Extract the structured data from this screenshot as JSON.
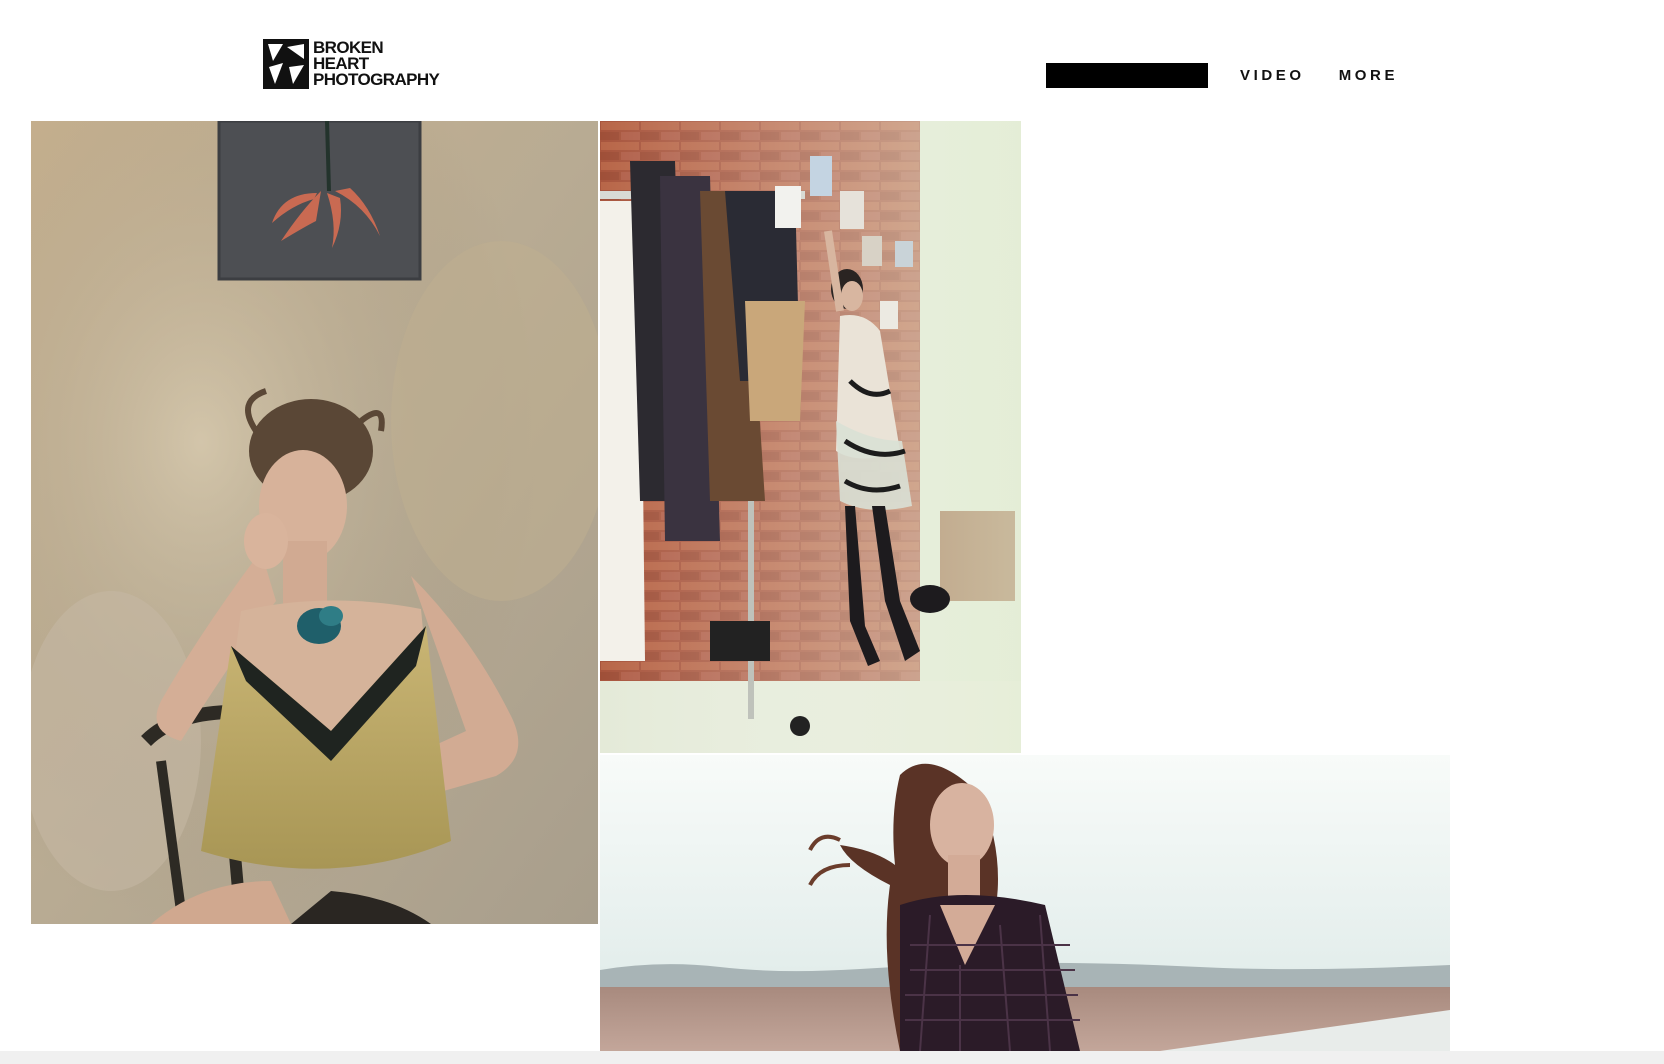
{
  "brand": {
    "name_lines": [
      "BROKEN",
      "HEART",
      "PHOTOGRAPHY"
    ],
    "logo_icon": "shattered-heart-mark"
  },
  "nav": {
    "active_item_label": "",
    "items": [
      {
        "label": "VIDEO"
      },
      {
        "label": "MORE"
      }
    ]
  },
  "gallery": {
    "photos": [
      {
        "subject": "woman in gold slip seated against weathered wall"
      },
      {
        "subject": "model in boots leaning against brick wall beside clothing rack"
      },
      {
        "subject": "woman with windswept hair in open field"
      }
    ]
  },
  "colors": {
    "background": "#ffffff",
    "text": "#111111",
    "nav_active": "#000000"
  }
}
